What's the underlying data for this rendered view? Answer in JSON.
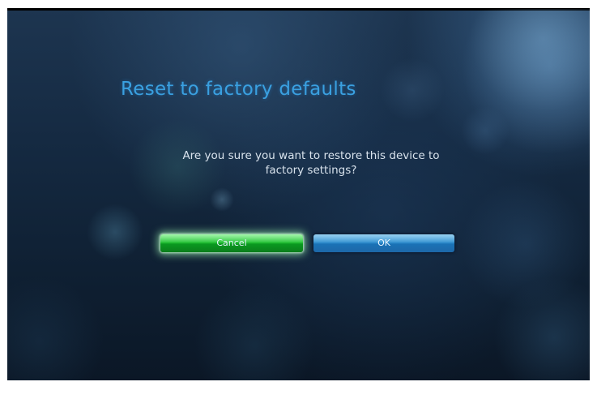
{
  "dialog": {
    "title": "Reset to factory defaults",
    "message_line1": "Are you sure you want to restore this device to",
    "message_line2": "factory settings?"
  },
  "buttons": {
    "cancel_label": "Cancel",
    "ok_label": "OK",
    "focused": "cancel"
  },
  "colors": {
    "title": "#3aa0e0",
    "cancel_button": "#22c234",
    "ok_button": "#2f8fcf",
    "background": "#152a42"
  }
}
